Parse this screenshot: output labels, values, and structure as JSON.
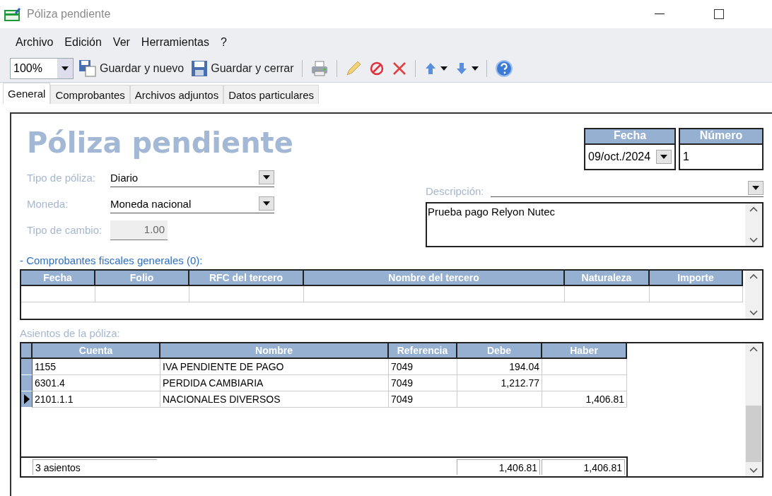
{
  "window": {
    "title": "Póliza pendiente"
  },
  "menu": [
    "Archivo",
    "Edición",
    "Ver",
    "Herramientas",
    "?"
  ],
  "toolbar": {
    "zoom": "100%",
    "items": [
      {
        "kind": "save-new",
        "label": "Guardar y nuevo"
      },
      {
        "kind": "save",
        "label": "Guardar y cerrar"
      },
      {
        "kind": "sep"
      },
      {
        "kind": "print"
      },
      {
        "kind": "sep"
      },
      {
        "kind": "edit"
      },
      {
        "kind": "cancel"
      },
      {
        "kind": "delete"
      },
      {
        "kind": "sep"
      },
      {
        "kind": "up"
      },
      {
        "kind": "down"
      },
      {
        "kind": "sep"
      },
      {
        "kind": "help"
      }
    ]
  },
  "tabs": [
    {
      "label": "General",
      "selected": true
    },
    {
      "label": "Comprobantes",
      "selected": false
    },
    {
      "label": "Archivos adjuntos",
      "selected": false
    },
    {
      "label": "Datos particulares",
      "selected": false
    }
  ],
  "form": {
    "heading": "Póliza pendiente",
    "fields": [
      {
        "label": "Tipo de póliza:",
        "value": "Diario",
        "kind": "combo"
      },
      {
        "label": "Moneda:",
        "value": "Moneda nacional",
        "kind": "combo"
      },
      {
        "label": "Tipo de cambio:",
        "value": "1.00",
        "kind": "readonly"
      }
    ],
    "fecha": {
      "label": "Fecha",
      "value": "09/oct./2024"
    },
    "numero": {
      "label": "Número",
      "value": "1"
    },
    "descripcion": {
      "label": "Descripción:",
      "text": "Prueba pago Relyon Nutec"
    }
  },
  "cfdi": {
    "title": "- Comprobantes fiscales generales (0):",
    "columns": [
      "Fecha",
      "Folio",
      "RFC del tercero",
      "Nombre del tercero",
      "Naturaleza",
      "Importe"
    ]
  },
  "asientos": {
    "title": "Asientos de la póliza:",
    "columns": [
      "Cuenta",
      "Nombre",
      "Referencia",
      "Debe",
      "Haber"
    ],
    "rows": [
      {
        "cells": [
          "1155",
          "IVA PENDIENTE DE PAGO",
          "7049",
          "194.04",
          ""
        ],
        "selected": false
      },
      {
        "cells": [
          "6301.4",
          "PERDIDA CAMBIARIA",
          "7049",
          "1,212.77",
          ""
        ],
        "selected": false
      },
      {
        "cells": [
          "2101.1.1",
          "NACIONALES DIVERSOS",
          "7049",
          "",
          "1,406.81"
        ],
        "selected": true
      }
    ],
    "footer": {
      "count": "3 asientos",
      "debe": "1,406.81",
      "haber": "1,406.81"
    }
  }
}
